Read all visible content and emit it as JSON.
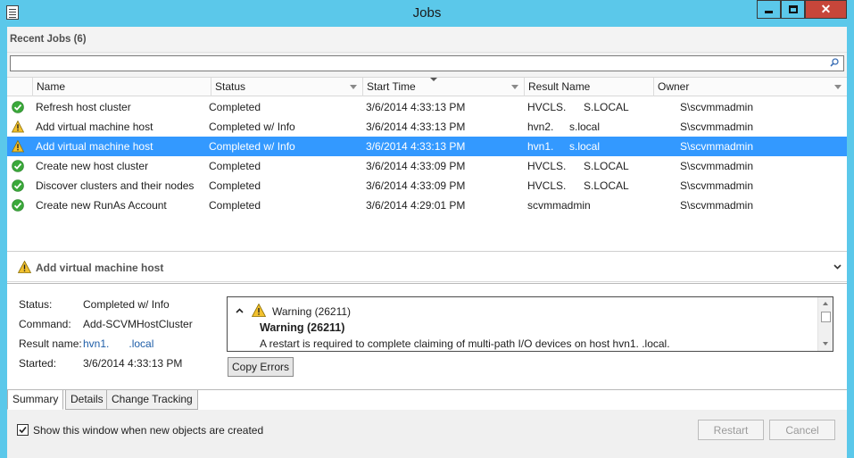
{
  "window": {
    "title": "Jobs"
  },
  "recent_jobs": {
    "label": "Recent Jobs (6)"
  },
  "search": {
    "value": "",
    "placeholder": ""
  },
  "columns": {
    "name": "Name",
    "status": "Status",
    "start_time": "Start Time",
    "result_name": "Result Name",
    "owner": "Owner"
  },
  "jobs": [
    {
      "icon": "success-check-icon",
      "name": "Refresh host cluster",
      "status": "Completed",
      "start_time": "3/6/2014 4:33:13 PM",
      "result_a": "HVCLS.",
      "result_b": "S.LOCAL",
      "owner": "S\\scvmmadmin",
      "selected": false
    },
    {
      "icon": "warning-icon",
      "name": "Add virtual machine host",
      "status": "Completed w/ Info",
      "start_time": "3/6/2014 4:33:13 PM",
      "result_a": "hvn2.",
      "result_b": "s.local",
      "owner": "S\\scvmmadmin",
      "selected": false
    },
    {
      "icon": "warning-icon",
      "name": "Add virtual machine host",
      "status": "Completed w/ Info",
      "start_time": "3/6/2014 4:33:13 PM",
      "result_a": "hvn1.",
      "result_b": "s.local",
      "owner": "S\\scvmmadmin",
      "selected": true
    },
    {
      "icon": "success-check-icon",
      "name": "Create new host cluster",
      "status": "Completed",
      "start_time": "3/6/2014 4:33:09 PM",
      "result_a": "HVCLS.",
      "result_b": "S.LOCAL",
      "owner": "S\\scvmmadmin",
      "selected": false
    },
    {
      "icon": "success-check-icon",
      "name": "Discover clusters and their nodes",
      "status": "Completed",
      "start_time": "3/6/2014 4:33:09 PM",
      "result_a": "HVCLS.",
      "result_b": "S.LOCAL",
      "owner": "S\\scvmmadmin",
      "selected": false
    },
    {
      "icon": "success-check-icon",
      "name": "Create new RunAs Account",
      "status": "Completed",
      "start_time": "3/6/2014 4:29:01 PM",
      "result_a": "scvmmadmin",
      "result_b": "",
      "owner": "S\\scvmmadmin",
      "selected": false
    }
  ],
  "detail": {
    "title": "Add virtual machine host",
    "status_label": "Status:",
    "status_value": "Completed w/ Info",
    "command_label": "Command:",
    "command_value": "Add-SCVMHostCluster",
    "result_label": "Result name:",
    "result_value_a": "hvn1.",
    "result_value_b": ".local",
    "started_label": "Started:",
    "started_value": "3/6/2014 4:33:13 PM",
    "warning_heading": "Warning (26211)",
    "warning_bold": "Warning (26211)",
    "warning_message": "A restart is required to complete claiming of multi-path I/O devices on host hvn1.        .local.",
    "copy_errors_label": "Copy Errors"
  },
  "tabs": [
    "Summary",
    "Details",
    "Change Tracking"
  ],
  "footer": {
    "checkbox_label": "Show this window when new objects are created",
    "checkbox_checked": true,
    "restart_label": "Restart",
    "cancel_label": "Cancel"
  },
  "colors": {
    "titlebar": "#5bc8ea",
    "selection": "#3399ff",
    "close_button": "#c7463a",
    "success": "#3aa83a",
    "warning": "#f2c12e"
  }
}
